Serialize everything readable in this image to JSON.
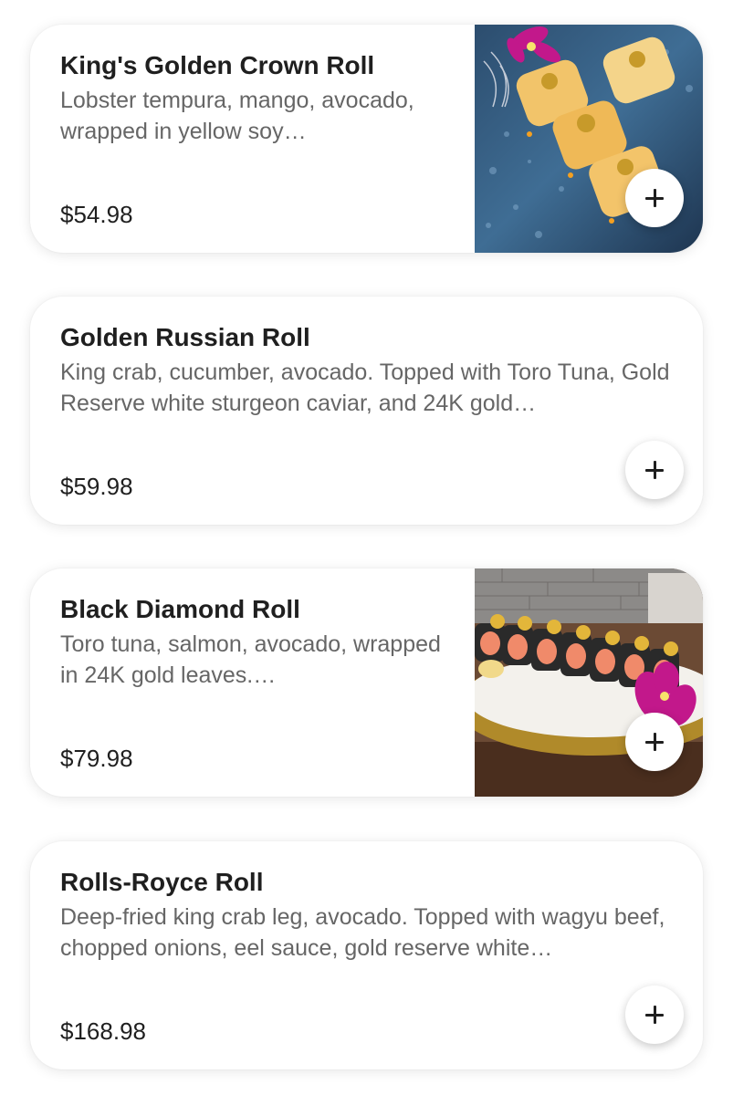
{
  "menu": {
    "items": [
      {
        "name": "King's Golden Crown Roll",
        "description": "Lobster tempura, mango, avocado, wrapped in yellow soy…",
        "price": "$54.98",
        "image": "sushi-roll-golden-crown-photo"
      },
      {
        "name": "Golden Russian Roll",
        "description": "King crab, cucumber, avocado. Topped with Toro Tuna, Gold Reserve white sturgeon caviar, and 24K gold…",
        "price": "$59.98"
      },
      {
        "name": "Black Diamond Roll",
        "description": "Toro tuna, salmon, avocado, wrapped in 24K gold leaves.…",
        "price": "$79.98",
        "image": "sushi-roll-black-diamond-photo"
      },
      {
        "name": "Rolls-Royce Roll",
        "description": "Deep-fried king crab leg, avocado. Topped with wagyu beef, chopped onions, eel sauce, gold reserve white…",
        "price": "$168.98"
      }
    ],
    "add_icon": "plus-icon"
  },
  "colors": {
    "card_background": "#ffffff",
    "title_text": "#1f1f1f",
    "description_text": "#666666",
    "price_text": "#1f1f1f"
  }
}
